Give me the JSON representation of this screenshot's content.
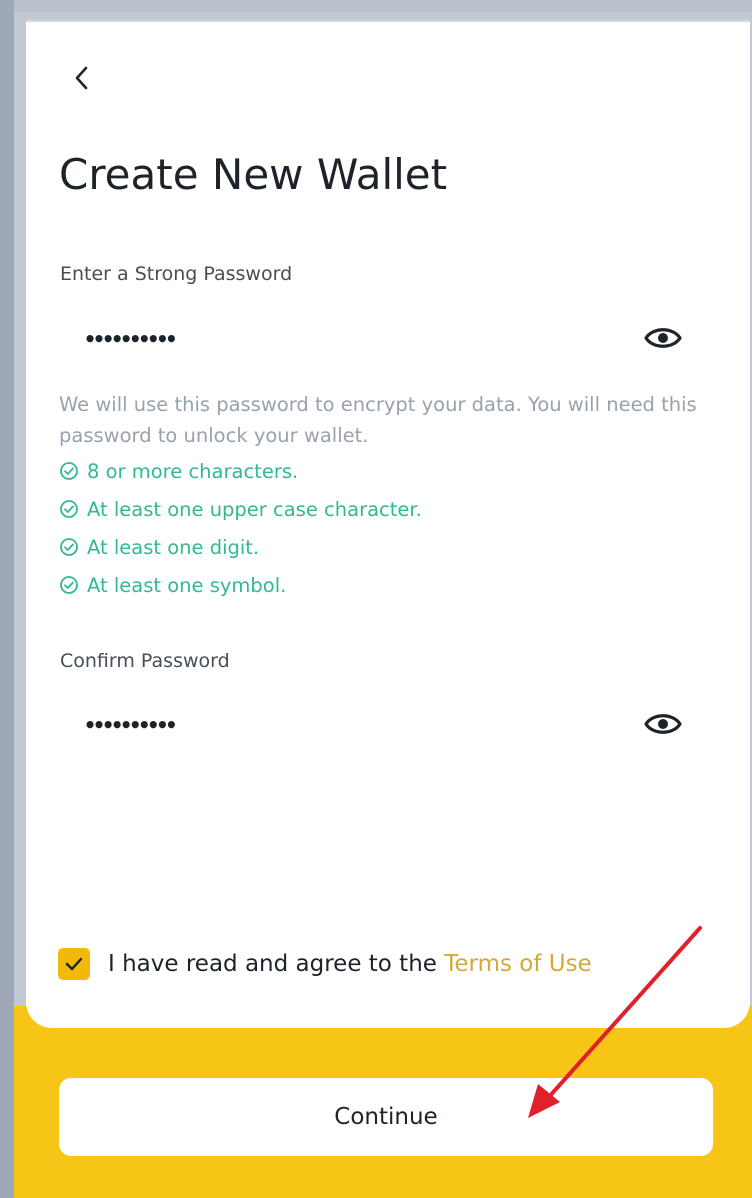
{
  "header": {
    "back_icon": "chevron-left-icon"
  },
  "page": {
    "title": "Create New Wallet"
  },
  "password": {
    "label": "Enter a Strong Password",
    "value": "••••••••••",
    "toggle_icon": "eye-icon"
  },
  "help_text": "We will use this password to encrypt your data. You will need this password to unlock your wallet.",
  "requirements": [
    {
      "text": "8 or more characters.",
      "met": true
    },
    {
      "text": "At least one upper case character.",
      "met": true
    },
    {
      "text": "At least one digit.",
      "met": true
    },
    {
      "text": "At least one symbol.",
      "met": true
    }
  ],
  "confirm": {
    "label": "Confirm Password",
    "value": "••••••••••",
    "toggle_icon": "eye-icon"
  },
  "agreement": {
    "checked": true,
    "prefix": "I have read and agree to the",
    "link": "Terms of Use"
  },
  "continue_button": {
    "label": "Continue"
  },
  "colors": {
    "accent": "#f0b90b",
    "success": "#33b891",
    "annotation_arrow": "#e0202a"
  }
}
